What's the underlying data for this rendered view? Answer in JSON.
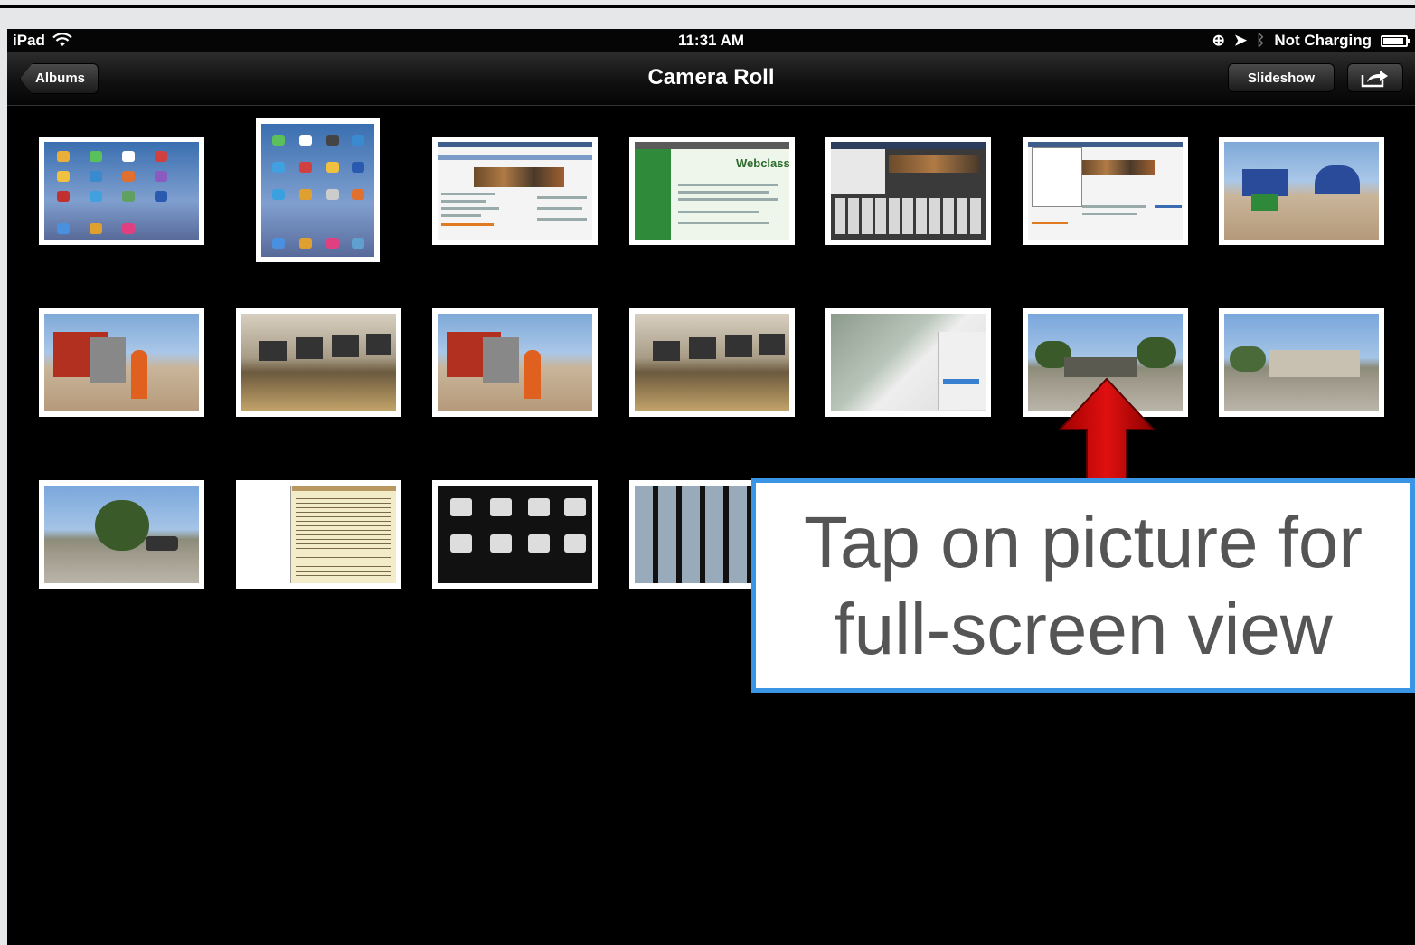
{
  "status_bar": {
    "device": "iPad",
    "time": "11:31 AM",
    "charging": "Not Charging",
    "icons": [
      "wifi-icon",
      "rotation-lock-icon",
      "location-icon",
      "bluetooth-icon",
      "battery-icon"
    ],
    "battery_level": 0.9
  },
  "nav": {
    "back_label": "Albums",
    "title": "Camera Roll",
    "slideshow_label": "Slideshow",
    "share_icon": "share-icon"
  },
  "annotation": {
    "line1": "Tap on picture for",
    "line2": "full-screen view",
    "arrow_icon": "red-up-arrow-icon"
  },
  "web_thumb_label": "Webclass",
  "colors": {
    "callout_border": "#3a95e6",
    "arrow": "#cc0000",
    "background": "#000000"
  }
}
